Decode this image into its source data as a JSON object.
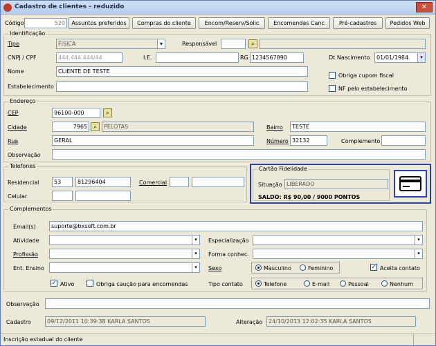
{
  "window": {
    "title": "Cadastro de clientes - reduzido",
    "close": "✕"
  },
  "toolbar": {
    "codigo_label": "Código",
    "codigo_value": "520",
    "buttons": [
      "Assuntos preferidos",
      "Compras do cliente",
      "Encom/Reserv/Solic",
      "Encomendas Canc",
      "Pré-cadastros",
      "Pedidos Web"
    ]
  },
  "identificacao": {
    "title": "Identificação",
    "tipo_label": "Tipo",
    "tipo_value": "FISICA",
    "responsavel_label": "Responsável",
    "cnpj_label": "CNPJ / CPF",
    "cnpj_value": "444.444.444/44",
    "ie_label": "I.E.",
    "rg_label": "RG",
    "rg_value": "1234567890",
    "nasc_label": "Dt Nascimento",
    "nasc_value": "01/01/1984",
    "nome_label": "Nome",
    "nome_value": "CLIENTE DE TESTE",
    "estab_label": "Estabelecimento",
    "cupom_label": "Obriga cupom fiscal",
    "nf_label": "NF pelo estabelecimento"
  },
  "endereco": {
    "title": "Endereço",
    "cep_label": "CEP",
    "cep_value": "96100-000",
    "cidade_label": "Cidade",
    "cidade_code": "7965",
    "cidade_value": "PELOTAS",
    "bairro_label": "Bairro",
    "bairro_value": "TESTE",
    "rua_label": "Rua",
    "rua_value": "GERAL",
    "numero_label": "Número",
    "numero_value": "32132",
    "complemento_label": "Complemento",
    "obs_label": "Observação"
  },
  "telefones": {
    "title": "Telefones",
    "residencial_label": "Residencial",
    "residencial_ddd": "53",
    "residencial_num": "81296404",
    "comercial_label": "Comercial",
    "celular_label": "Celular"
  },
  "fidelidade": {
    "title": "Cartão Fidelidade",
    "situacao_label": "Situação",
    "situacao_value": "LIBERADO",
    "saldo": "SALDO: R$ 90,00 / 9000 PONTOS",
    "border_color": "#2a3fb0"
  },
  "complementos": {
    "title": "Complementos",
    "email_label": "Email(s)",
    "email_value": "suporte@bxsoft.com.br",
    "atividade_label": "Atividade",
    "profissao_label": "Profissão",
    "ensino_label": "Ent. Ensino",
    "especializacao_label": "Especialização",
    "forma_label": "Forma conhec.",
    "sexo_label": "Sexo",
    "sexo_masc": "Masculino",
    "sexo_fem": "Feminino",
    "aceita_label": "Aceita contato",
    "ativo_label": "Ativo",
    "caucao_label": "Obriga caução para encomendas",
    "tipo_contato_label": "Tipo contato",
    "contato_opts": [
      "Telefone",
      "E-mail",
      "Pessoal",
      "Nenhum"
    ]
  },
  "footer": {
    "obs_label": "Observação",
    "cadastro_label": "Cadastro",
    "cadastro_value": "09/12/2011 10:39:38 KARLA SANTOS",
    "alteracao_label": "Alteração",
    "alteracao_value": "24/10/2013 12:02:35 KARLA SANTOS",
    "status": "Inscrição estadual do cliente"
  }
}
